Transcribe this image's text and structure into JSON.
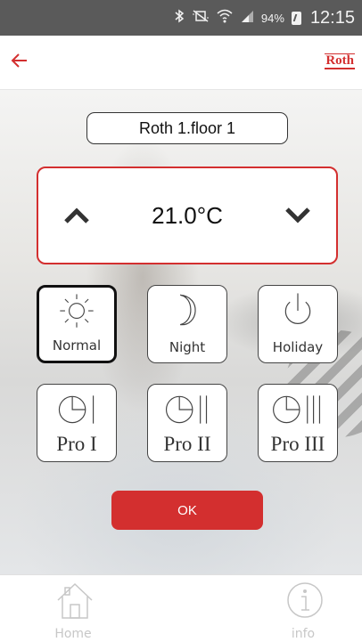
{
  "status_bar": {
    "battery_percent": "94%",
    "time": "12:15",
    "icons": [
      "bluetooth-icon",
      "mute-icon",
      "wifi-icon",
      "signal-icon",
      "battery-icon"
    ]
  },
  "app_bar": {
    "back_icon": "back-arrow-icon",
    "brand": "Roth"
  },
  "room": {
    "name": "Roth 1.floor 1"
  },
  "thermostat": {
    "temperature": "21.0°C"
  },
  "modes": [
    {
      "label": "Normal",
      "icon": "sun-icon",
      "selected": true
    },
    {
      "label": "Night",
      "icon": "moon-icon",
      "selected": false
    },
    {
      "label": "Holiday",
      "icon": "power-icon",
      "selected": false
    },
    {
      "label": "Pro I",
      "icon": "clock-program-1-icon",
      "selected": false
    },
    {
      "label": "Pro II",
      "icon": "clock-program-2-icon",
      "selected": false
    },
    {
      "label": "Pro III",
      "icon": "clock-program-3-icon",
      "selected": false
    }
  ],
  "ok_label": "OK",
  "bottom_nav": {
    "home_label": "Home",
    "info_label": "info"
  },
  "colors": {
    "accent": "#d32f2f",
    "status_bar": "#5a5a5a",
    "nav_inactive": "#c7c7c7"
  }
}
